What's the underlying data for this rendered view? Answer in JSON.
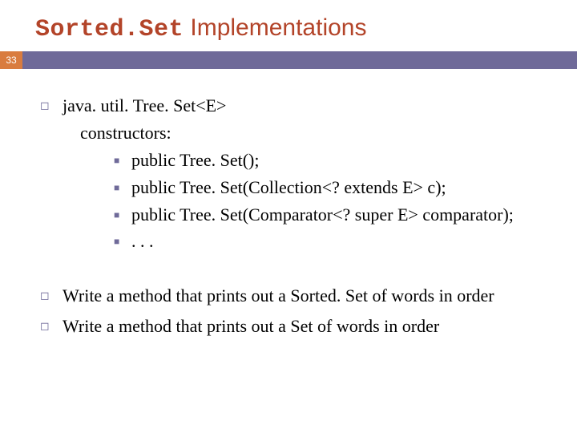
{
  "title": {
    "code": "Sorted.Set",
    "rest": " Implementations"
  },
  "page_number": "33",
  "section1": {
    "heading": "java. util. Tree. Set<E>",
    "sub": "constructors:",
    "items": [
      "public Tree. Set();",
      "public Tree. Set(Collection<? extends E> c);",
      "public Tree. Set(Comparator<? super E> comparator);",
      ". . ."
    ]
  },
  "section2": {
    "items": [
      "Write a method that prints out a Sorted. Set of words in order",
      "Write a method that prints out a Set of words in order"
    ]
  }
}
